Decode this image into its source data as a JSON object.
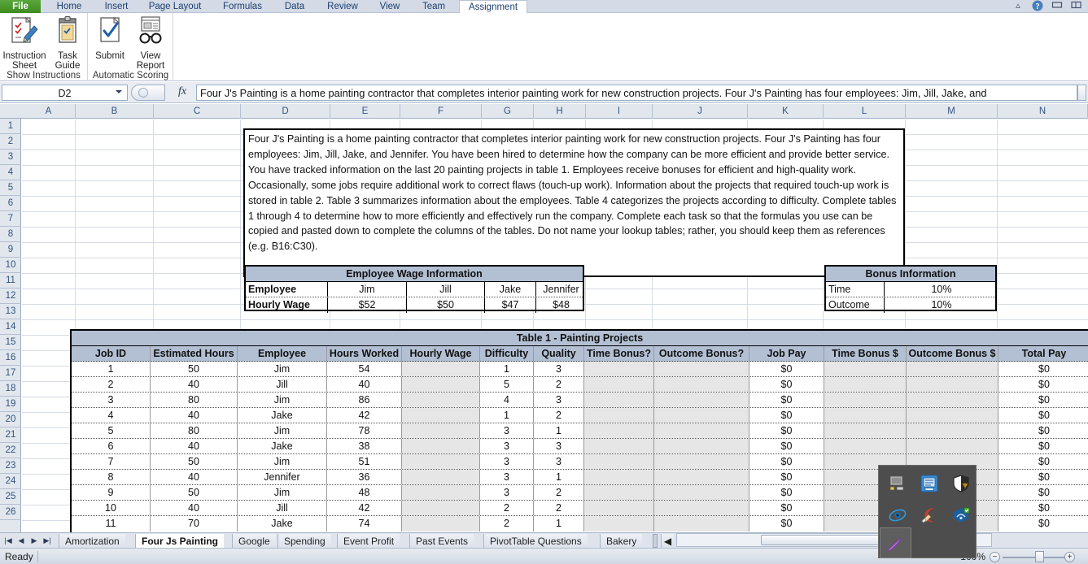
{
  "window": {
    "title_icons": [
      "minimize-restore-icon",
      "help-icon",
      "restore-window-icon",
      "restore-pane-icon"
    ]
  },
  "ribbon": {
    "tabs": [
      {
        "label": "File",
        "active": false,
        "file": true
      },
      {
        "label": "Home",
        "active": false
      },
      {
        "label": "Insert",
        "active": false
      },
      {
        "label": "Page Layout",
        "active": false
      },
      {
        "label": "Formulas",
        "active": false
      },
      {
        "label": "Data",
        "active": false
      },
      {
        "label": "Review",
        "active": false
      },
      {
        "label": "View",
        "active": false
      },
      {
        "label": "Team",
        "active": false
      },
      {
        "label": "Assignment",
        "active": true
      }
    ],
    "groups": [
      {
        "name": "Show Instructions",
        "buttons": [
          {
            "line1": "Instruction",
            "line2": "Sheet",
            "icon": "instruction-sheet-icon"
          },
          {
            "line1": "Task",
            "line2": "Guide",
            "icon": "task-guide-icon"
          }
        ]
      },
      {
        "name": "Automatic Scoring",
        "buttons": [
          {
            "line1": "Submit",
            "line2": "",
            "icon": "submit-check-icon"
          },
          {
            "line1": "View",
            "line2": "Report",
            "icon": "view-report-glasses-icon"
          }
        ]
      }
    ]
  },
  "formula_bar": {
    "name_box": "D2",
    "formula": "Four J's Painting is a home painting contractor that completes interior painting work for new construction projects. Four J's Painting has four employees: Jim, Jill, Jake, and"
  },
  "grid": {
    "columns": [
      "A",
      "B",
      "C",
      "D",
      "E",
      "F",
      "G",
      "H",
      "I",
      "J",
      "K",
      "L",
      "M",
      "N"
    ],
    "rows": [
      1,
      2,
      3,
      4,
      5,
      6,
      7,
      8,
      9,
      10,
      11,
      12,
      13,
      14,
      15,
      16,
      17,
      18,
      19,
      20,
      21,
      22,
      23,
      24,
      25,
      26
    ]
  },
  "description_box": {
    "text": "Four J's Painting is a home painting contractor that completes interior painting work for new construction projects. Four J's Painting has four employees: Jim, Jill, Jake, and Jennifer. You have been hired to determine how the company can be more efficient and provide better service. You have tracked information on the last 20 painting projects in table 1. Employees receive bonuses for efficient and high-quality work. Occasionally, some jobs require additional work to correct flaws (touch-up work). Information about the projects that required touch-up work is stored in table 2. Table 3 summarizes information about the employees. Table 4 categorizes the projects according to difficulty. Complete tables 1 through 4 to determine how to more efficiently and effectively run the company. Complete each task so that the formulas you use can be copied and pasted down to complete the columns of the tables. Do not name your lookup tables; rather, you should keep them as references (e.g. B16:C30)."
  },
  "wage_table": {
    "title": "Employee Wage Information",
    "rows": [
      {
        "label": "Employee",
        "values": [
          "Jim",
          "Jill",
          "Jake",
          "Jennifer"
        ]
      },
      {
        "label": "Hourly Wage",
        "values": [
          "$52",
          "$50",
          "$47",
          "$48"
        ]
      }
    ]
  },
  "bonus_table": {
    "title": "Bonus Information",
    "rows": [
      {
        "label": "Time",
        "value": "10%"
      },
      {
        "label": "Outcome",
        "value": "10%"
      }
    ]
  },
  "table1": {
    "title": "Table 1 - Painting Projects",
    "headers": [
      "Job ID",
      "Estimated Hours",
      "Employee",
      "Hours Worked",
      "Hourly Wage",
      "Difficulty",
      "Quality",
      "Time Bonus?",
      "Outcome Bonus?",
      "Job Pay",
      "Time Bonus $",
      "Outcome Bonus $",
      "Total Pay"
    ],
    "rows": [
      {
        "job_id": "1",
        "estimated_hours": "50",
        "employee": "Jim",
        "hours_worked": "54",
        "hourly_wage": "",
        "difficulty": "1",
        "quality": "3",
        "time_bonus_q": "",
        "outcome_bonus_q": "",
        "job_pay": "$0",
        "time_bonus_d": "",
        "outcome_bonus_d": "",
        "total_pay": "$0"
      },
      {
        "job_id": "2",
        "estimated_hours": "40",
        "employee": "Jill",
        "hours_worked": "40",
        "hourly_wage": "",
        "difficulty": "5",
        "quality": "2",
        "time_bonus_q": "",
        "outcome_bonus_q": "",
        "job_pay": "$0",
        "time_bonus_d": "",
        "outcome_bonus_d": "",
        "total_pay": "$0"
      },
      {
        "job_id": "3",
        "estimated_hours": "80",
        "employee": "Jim",
        "hours_worked": "86",
        "hourly_wage": "",
        "difficulty": "4",
        "quality": "3",
        "time_bonus_q": "",
        "outcome_bonus_q": "",
        "job_pay": "$0",
        "time_bonus_d": "",
        "outcome_bonus_d": "",
        "total_pay": "$0"
      },
      {
        "job_id": "4",
        "estimated_hours": "40",
        "employee": "Jake",
        "hours_worked": "42",
        "hourly_wage": "",
        "difficulty": "1",
        "quality": "2",
        "time_bonus_q": "",
        "outcome_bonus_q": "",
        "job_pay": "$0",
        "time_bonus_d": "",
        "outcome_bonus_d": "",
        "total_pay": "$0"
      },
      {
        "job_id": "5",
        "estimated_hours": "80",
        "employee": "Jim",
        "hours_worked": "78",
        "hourly_wage": "",
        "difficulty": "3",
        "quality": "1",
        "time_bonus_q": "",
        "outcome_bonus_q": "",
        "job_pay": "$0",
        "time_bonus_d": "",
        "outcome_bonus_d": "",
        "total_pay": "$0"
      },
      {
        "job_id": "6",
        "estimated_hours": "40",
        "employee": "Jake",
        "hours_worked": "38",
        "hourly_wage": "",
        "difficulty": "3",
        "quality": "3",
        "time_bonus_q": "",
        "outcome_bonus_q": "",
        "job_pay": "$0",
        "time_bonus_d": "",
        "outcome_bonus_d": "",
        "total_pay": "$0"
      },
      {
        "job_id": "7",
        "estimated_hours": "50",
        "employee": "Jim",
        "hours_worked": "51",
        "hourly_wage": "",
        "difficulty": "3",
        "quality": "3",
        "time_bonus_q": "",
        "outcome_bonus_q": "",
        "job_pay": "$0",
        "time_bonus_d": "",
        "outcome_bonus_d": "",
        "total_pay": "$0"
      },
      {
        "job_id": "8",
        "estimated_hours": "40",
        "employee": "Jennifer",
        "hours_worked": "36",
        "hourly_wage": "",
        "difficulty": "3",
        "quality": "1",
        "time_bonus_q": "",
        "outcome_bonus_q": "",
        "job_pay": "$0",
        "time_bonus_d": "",
        "outcome_bonus_d": "",
        "total_pay": "$0"
      },
      {
        "job_id": "9",
        "estimated_hours": "50",
        "employee": "Jim",
        "hours_worked": "48",
        "hourly_wage": "",
        "difficulty": "3",
        "quality": "2",
        "time_bonus_q": "",
        "outcome_bonus_q": "",
        "job_pay": "$0",
        "time_bonus_d": "",
        "outcome_bonus_d": "",
        "total_pay": "$0"
      },
      {
        "job_id": "10",
        "estimated_hours": "40",
        "employee": "Jill",
        "hours_worked": "42",
        "hourly_wage": "",
        "difficulty": "2",
        "quality": "2",
        "time_bonus_q": "",
        "outcome_bonus_q": "",
        "job_pay": "$0",
        "time_bonus_d": "",
        "outcome_bonus_d": "",
        "total_pay": "$0"
      },
      {
        "job_id": "11",
        "estimated_hours": "70",
        "employee": "Jake",
        "hours_worked": "74",
        "hourly_wage": "",
        "difficulty": "2",
        "quality": "1",
        "time_bonus_q": "",
        "outcome_bonus_q": "",
        "job_pay": "$0",
        "time_bonus_d": "",
        "outcome_bonus_d": "",
        "total_pay": "$0"
      }
    ]
  },
  "sheet_tabs": {
    "nav_icons": [
      "first-sheet-icon",
      "prev-sheet-icon",
      "next-sheet-icon",
      "last-sheet-icon"
    ],
    "tabs": [
      {
        "label": "Amortization",
        "selected": false
      },
      {
        "label": "Four Js Painting",
        "selected": true
      },
      {
        "label": "Google",
        "selected": false
      },
      {
        "label": "Spending",
        "selected": false
      },
      {
        "label": "Event Profit",
        "selected": false
      },
      {
        "label": "Past Events",
        "selected": false
      },
      {
        "label": "PivotTable Questions",
        "selected": false
      },
      {
        "label": "Bakery",
        "selected": false
      }
    ]
  },
  "status_bar": {
    "mode": "Ready",
    "zoom": "100%"
  },
  "tray_popup": {
    "icons": [
      "display-settings-icon",
      "network-icon",
      "security-shield-warning-icon",
      "eye-monitor-icon",
      "ccleaner-icon",
      "network-connection-icon",
      "pen-tool-icon"
    ]
  },
  "colors": {
    "header_band": "#b3c0d4",
    "shaded_cell": "#e6e6e6",
    "file_tab_green": "#4e9a2a",
    "grid_line": "#d6dce5"
  }
}
